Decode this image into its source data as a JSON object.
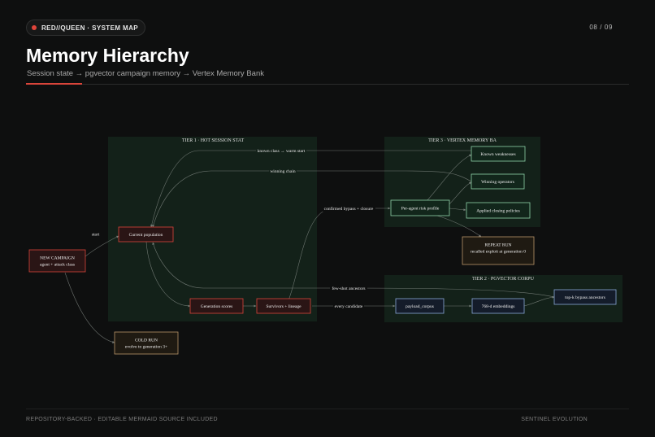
{
  "header": {
    "badge": "RED//QUEEN · SYSTEM MAP",
    "page": "08 / 09",
    "title": "Memory Hierarchy",
    "subtitle": "Session state → pgvector campaign memory → Vertex Memory Bank"
  },
  "tiers": {
    "tier1": "TIER 1 · HOT SESSION STAT",
    "tier3": "TIER 3 · VERTEX MEMORY BA",
    "tier2": "TIER 2 · PGVECTOR CORPU"
  },
  "nodes": {
    "new_campaign_1": "NEW CAMPAIGN",
    "new_campaign_2": "agent + attack class",
    "current_population": "Current population",
    "generation_scores": "Generation scores",
    "survivors_lineage": "Survivors + lineage",
    "cold_run_1": "COLD RUN",
    "cold_run_2": "evolve to generation 3+",
    "per_agent_risk": "Per-agent risk profile",
    "known_weaknesses": "Known weaknesses",
    "winning_operators": "Winning operators",
    "applied_closing": "Applied closing policies",
    "repeat_run_1": "REPEAT RUN",
    "repeat_run_2": "recalled exploit at generation 0",
    "payload_corpus": "payload_corpus",
    "embeddings": "768-d embeddings",
    "topk": "top-k bypass ancestors"
  },
  "edges": {
    "start": "start",
    "known_class": "known class → warm start",
    "winning_chain": "winning chain",
    "confirmed_bypass": "confirmed bypass + closure",
    "few_shot": "few-shot ancestors",
    "every_candidate": "every candidate"
  },
  "footer": {
    "left": "REPOSITORY-BACKED · EDITABLE MERMAID SOURCE INCLUDED",
    "right": "SENTINEL EVOLUTION"
  },
  "colors": {
    "accent": "#d9453a",
    "tier_bg": "#132119",
    "red_node": "#d9453a",
    "green_node": "#8fd4a8",
    "blue_node": "#8aa9d8",
    "amber_node": "#b8956a"
  }
}
